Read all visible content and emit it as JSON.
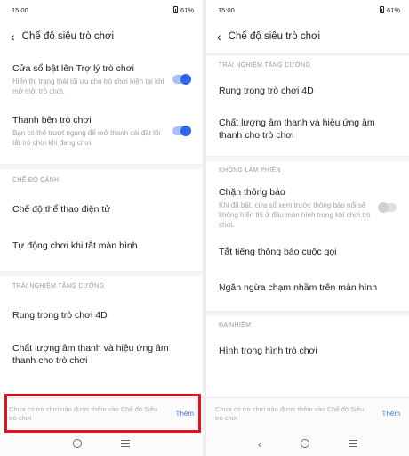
{
  "status": {
    "time": "15:00",
    "battery": "61%"
  },
  "left": {
    "title": "Chế độ siêu trò chơi",
    "toggle_items": [
      {
        "title": "Cửa sổ bật lên Trợ lý trò chơi",
        "desc": "Hiển thị trạng thái tối ưu cho trò chơi hiện tại khi mở một trò chơi.",
        "state": "on"
      },
      {
        "title": "Thanh bên trò chơi",
        "desc": "Bạn có thể trượt ngang để mở thanh cài đặt lối tắt trò chơi khi đang chơi.",
        "state": "on"
      }
    ],
    "section_scene": "CHẾ ĐỘ CẢNH",
    "scene_items": [
      "Chế độ thể thao điện tử",
      "Tự động chơi khi tắt màn hình"
    ],
    "section_enhanced": "TRẢI NGHIỆM TĂNG CƯỜNG",
    "enhanced_items": [
      "Rung trong trò chơi 4D",
      "Chất lượng âm thanh và hiệu ứng âm thanh cho trò chơi"
    ],
    "bottom_text": "Chưa có trò chơi nào được thêm vào Chế độ Siêu trò chơi",
    "add_label": "Thêm"
  },
  "right": {
    "title": "Chế độ siêu trò chơi",
    "section_enhanced": "TRẢI NGHIỆM TĂNG CƯỜNG",
    "enhanced_items": [
      "Rung trong trò chơi 4D",
      "Chất lượng âm thanh và hiệu ứng âm thanh cho trò chơi"
    ],
    "section_dnd": "KHÔNG LÀM PHIỀN",
    "block_notif": {
      "title": "Chặn thông báo",
      "desc": "Khi đã bật, cửa sổ xem trước thông báo nổi sẽ không hiển thị ở đầu màn hình trong khi chơi trò chơi.",
      "state": "off"
    },
    "dnd_items": [
      "Tắt tiếng thông báo cuộc gọi",
      "Ngăn ngừa chạm nhầm trên màn hình"
    ],
    "section_multitask": "ĐA NHIỆM",
    "multitask_items": [
      "Hình trong hình trò chơi"
    ],
    "bottom_text": "Chưa có trò chơi nào được thêm vào Chế độ Siêu trò chơi",
    "add_label": "Thêm"
  },
  "icons": {
    "back": "chevron-left-icon",
    "battery": "battery-icon",
    "nav_back": "nav-back-icon",
    "nav_home": "nav-home-icon",
    "nav_menu": "nav-menu-icon"
  },
  "colors": {
    "accent": "#2e66ee",
    "highlight": "#e0121b",
    "link": "#3a6fe6"
  }
}
